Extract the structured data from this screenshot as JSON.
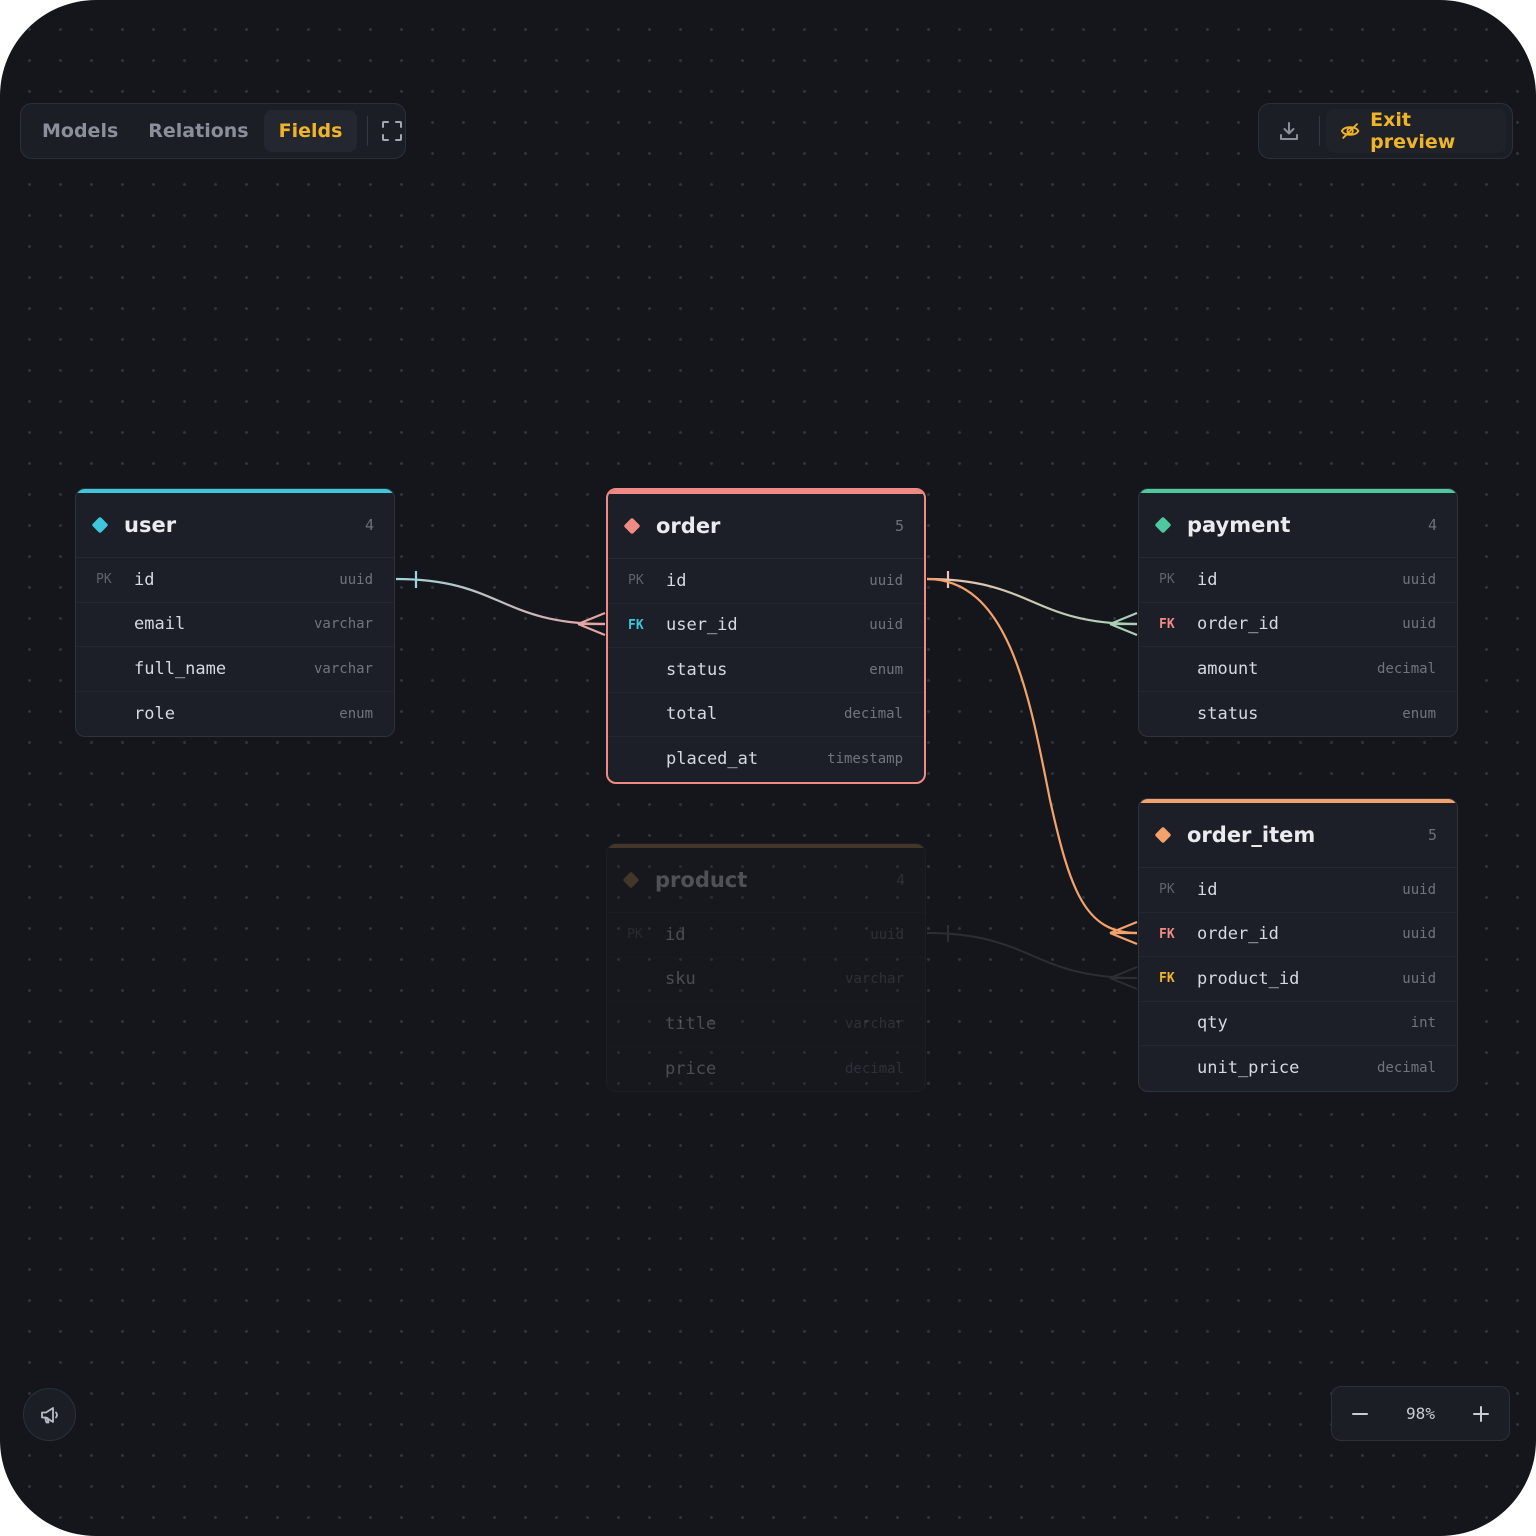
{
  "toolbar": {
    "tabs": [
      {
        "label": "Models"
      },
      {
        "label": "Relations"
      },
      {
        "label": "Fields"
      }
    ],
    "active_tab": "Fields",
    "fullscreen_icon": "fullscreen-icon"
  },
  "actions": {
    "download_icon": "download-icon",
    "exit_label": "Exit preview",
    "exit_icon": "eye-off-icon"
  },
  "colors": {
    "accent": "#f0b429",
    "user": "#3ec6dc",
    "order": "#f08a84",
    "payment": "#4fc79f",
    "order_item": "#f4a26c",
    "product": "#c08a4a"
  },
  "tables": {
    "user": {
      "name": "user",
      "count": "4",
      "fields": [
        {
          "key": "PK",
          "name": "id",
          "type": "uuid"
        },
        {
          "key": "",
          "name": "email",
          "type": "varchar"
        },
        {
          "key": "",
          "name": "full_name",
          "type": "varchar"
        },
        {
          "key": "",
          "name": "role",
          "type": "enum"
        }
      ]
    },
    "order": {
      "name": "order",
      "count": "5",
      "fields": [
        {
          "key": "PK",
          "name": "id",
          "type": "uuid"
        },
        {
          "key": "FK",
          "name": "user_id",
          "type": "uuid"
        },
        {
          "key": "",
          "name": "status",
          "type": "enum"
        },
        {
          "key": "",
          "name": "total",
          "type": "decimal"
        },
        {
          "key": "",
          "name": "placed_at",
          "type": "timestamp"
        }
      ]
    },
    "payment": {
      "name": "payment",
      "count": "4",
      "fields": [
        {
          "key": "PK",
          "name": "id",
          "type": "uuid"
        },
        {
          "key": "FK",
          "name": "order_id",
          "type": "uuid"
        },
        {
          "key": "",
          "name": "amount",
          "type": "decimal"
        },
        {
          "key": "",
          "name": "status",
          "type": "enum"
        }
      ]
    },
    "order_item": {
      "name": "order_item",
      "count": "5",
      "fields": [
        {
          "key": "PK",
          "name": "id",
          "type": "uuid"
        },
        {
          "key": "FK",
          "name": "order_id",
          "type": "uuid"
        },
        {
          "key": "FK",
          "name": "product_id",
          "type": "uuid"
        },
        {
          "key": "",
          "name": "qty",
          "type": "int"
        },
        {
          "key": "",
          "name": "unit_price",
          "type": "decimal"
        }
      ]
    },
    "product": {
      "name": "product",
      "count": "4",
      "fields": [
        {
          "key": "PK",
          "name": "id",
          "type": "uuid"
        },
        {
          "key": "",
          "name": "sku",
          "type": "varchar"
        },
        {
          "key": "",
          "name": "title",
          "type": "varchar"
        },
        {
          "key": "",
          "name": "price",
          "type": "decimal"
        }
      ]
    }
  },
  "zoom": {
    "value": "98%",
    "minus_icon": "minus-icon",
    "plus_icon": "plus-icon"
  },
  "sound_icon": "megaphone-icon"
}
